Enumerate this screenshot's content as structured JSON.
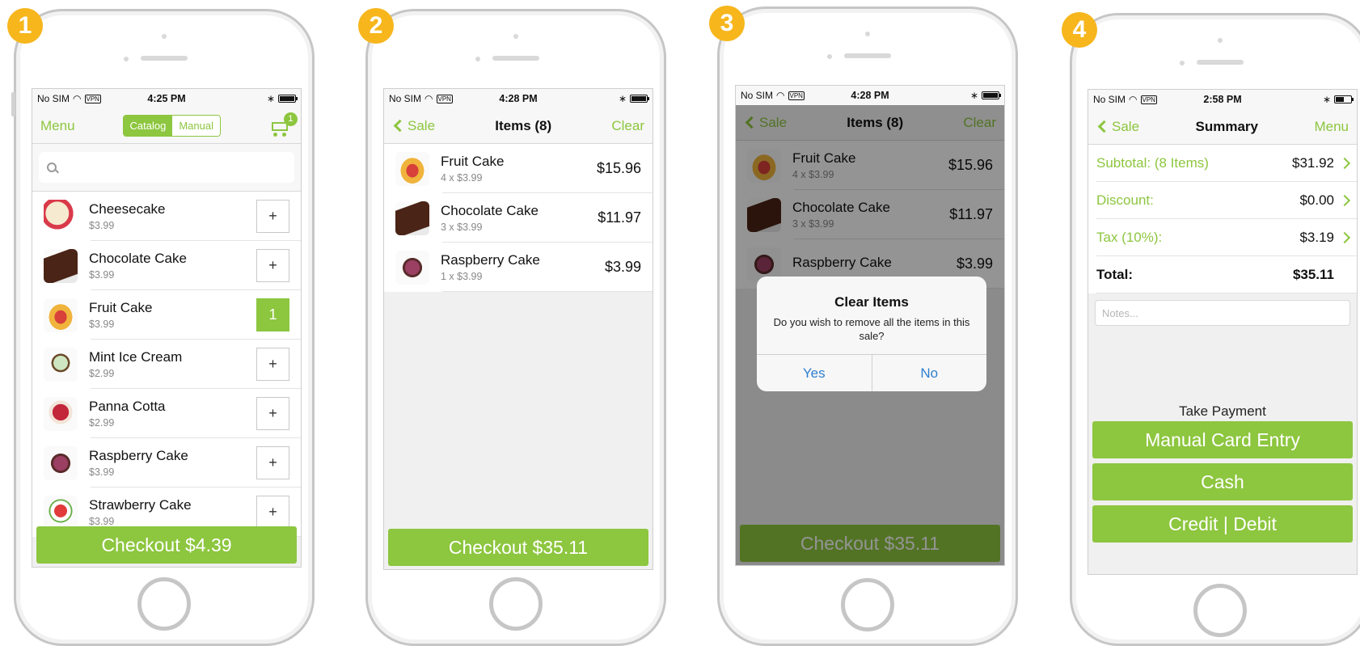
{
  "steps": [
    "1",
    "2",
    "3",
    "4"
  ],
  "colors": {
    "accent": "#8dc63f",
    "step_badge": "#f6b61c",
    "alert_button": "#2f7fd0"
  },
  "status": {
    "carrier": "No SIM",
    "vpn": "VPN",
    "time1": "4:25 PM",
    "time2": "4:28 PM",
    "time3": "4:28 PM",
    "time4": "2:58 PM"
  },
  "screen1": {
    "menu": "Menu",
    "seg_catalog": "Catalog",
    "seg_manual": "Manual",
    "cart_count": "1",
    "items": [
      {
        "name": "Cheesecake",
        "price": "$3.99",
        "qty": "+"
      },
      {
        "name": "Chocolate Cake",
        "price": "$3.99",
        "qty": "+"
      },
      {
        "name": "Fruit Cake",
        "price": "$3.99",
        "qty": "1"
      },
      {
        "name": "Mint Ice Cream",
        "price": "$2.99",
        "qty": "+"
      },
      {
        "name": "Panna Cotta",
        "price": "$2.99",
        "qty": "+"
      },
      {
        "name": "Raspberry Cake",
        "price": "$3.99",
        "qty": "+"
      },
      {
        "name": "Strawberry Cake",
        "price": "$3.99",
        "qty": "+"
      }
    ],
    "checkout": "Checkout $4.39"
  },
  "screen2": {
    "back": "Sale",
    "title": "Items (8)",
    "clear": "Clear",
    "items": [
      {
        "name": "Fruit Cake",
        "detail": "4 x $3.99",
        "total": "$15.96"
      },
      {
        "name": "Chocolate Cake",
        "detail": "3 x $3.99",
        "total": "$11.97"
      },
      {
        "name": "Raspberry Cake",
        "detail": "1 x $3.99",
        "total": "$3.99"
      }
    ],
    "checkout": "Checkout $35.11"
  },
  "screen3": {
    "back": "Sale",
    "title": "Items (8)",
    "clear": "Clear",
    "items": [
      {
        "name": "Fruit Cake",
        "detail": "4 x $3.99",
        "total": "$15.96"
      },
      {
        "name": "Chocolate Cake",
        "detail": "3 x $3.99",
        "total": "$11.97"
      },
      {
        "name": "Raspberry Cake",
        "detail": "",
        "total": "$3.99"
      }
    ],
    "alert": {
      "title": "Clear Items",
      "message": "Do you wish to remove all the items in this sale?",
      "yes": "Yes",
      "no": "No"
    },
    "checkout": "Checkout $35.11"
  },
  "screen4": {
    "back": "Sale",
    "title": "Summary",
    "menu": "Menu",
    "subtotal_label": "Subtotal: (8 Items)",
    "subtotal_value": "$31.92",
    "discount_label": "Discount:",
    "discount_value": "$0.00",
    "tax_label": "Tax (10%):",
    "tax_value": "$3.19",
    "total_label": "Total:",
    "total_value": "$35.11",
    "notes_placeholder": "Notes...",
    "take_payment": "Take Payment",
    "pay_manual": "Manual Card Entry",
    "pay_cash": "Cash",
    "pay_card": "Credit | Debit"
  }
}
